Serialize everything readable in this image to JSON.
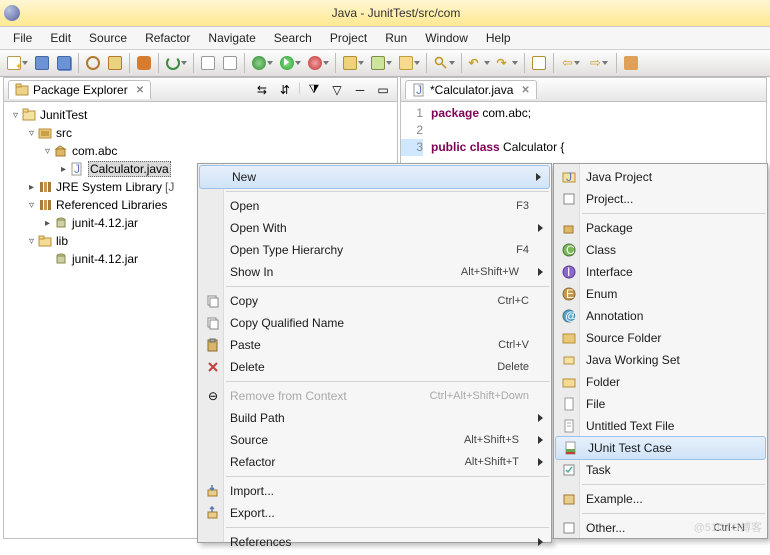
{
  "titlebar": {
    "title": "Java - JunitTest/src/com"
  },
  "menubar": [
    "File",
    "Edit",
    "Source",
    "Refactor",
    "Navigate",
    "Search",
    "Project",
    "Run",
    "Window",
    "Help"
  ],
  "pkg_explorer": {
    "title": "Package Explorer",
    "project": "JunitTest",
    "src": "src",
    "pkg": "com.abc",
    "file_selected": "Calculator.java",
    "jre": "JRE System Library",
    "jre_suffix": "[J",
    "ref": "Referenced Libraries",
    "junit_jar": "junit-4.12.jar",
    "lib": "lib",
    "lib_jar": "junit-4.12.jar"
  },
  "editor": {
    "tab": "*Calculator.java",
    "line1": "1",
    "line2": "2",
    "line3": "3",
    "code1_kw": "package",
    "code1_rest": " com.abc;",
    "code3_kw1": "public",
    "code3_kw2": "class",
    "code3_rest": " Calculator {"
  },
  "ctx1": {
    "new": "New",
    "open": "Open",
    "open_k": "F3",
    "openwith": "Open With",
    "opentype": "Open Type Hierarchy",
    "opentype_k": "F4",
    "showin": "Show In",
    "showin_k": "Alt+Shift+W",
    "copy": "Copy",
    "copy_k": "Ctrl+C",
    "copyq": "Copy Qualified Name",
    "paste": "Paste",
    "paste_k": "Ctrl+V",
    "delete": "Delete",
    "delete_k": "Delete",
    "remove": "Remove from Context",
    "remove_k": "Ctrl+Alt+Shift+Down",
    "buildpath": "Build Path",
    "source": "Source",
    "source_k": "Alt+Shift+S",
    "refactor": "Refactor",
    "refactor_k": "Alt+Shift+T",
    "import": "Import...",
    "export": "Export...",
    "references": "References"
  },
  "ctx2": {
    "javaproj": "Java Project",
    "project": "Project...",
    "package": "Package",
    "class": "Class",
    "interface": "Interface",
    "enum": "Enum",
    "annotation": "Annotation",
    "srcfolder": "Source Folder",
    "workingset": "Java Working Set",
    "folder": "Folder",
    "file": "File",
    "untitled": "Untitled Text File",
    "junit": "JUnit Test Case",
    "task": "Task",
    "example": "Example...",
    "other": "Other...",
    "other_k": "Ctrl+N"
  }
}
